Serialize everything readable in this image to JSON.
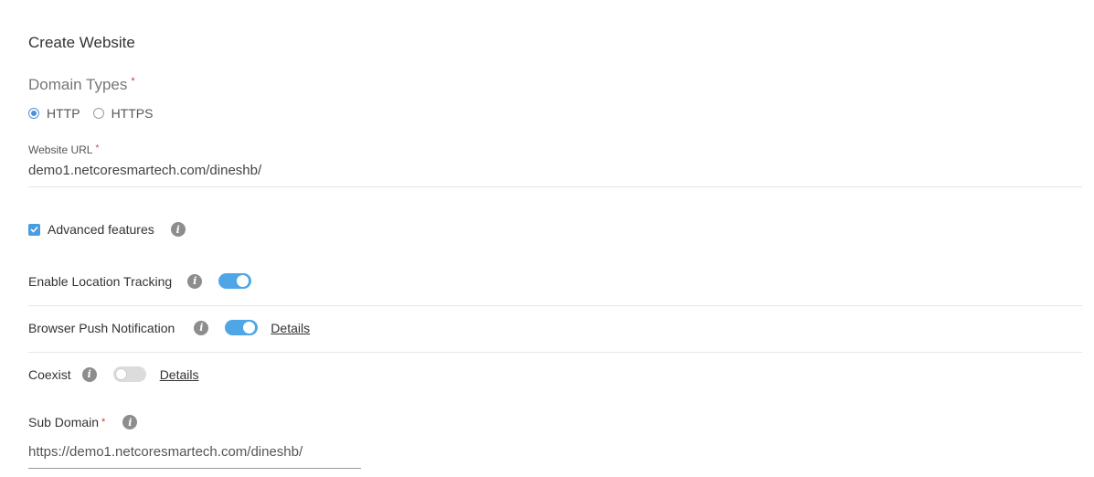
{
  "page": {
    "title": "Create Website"
  },
  "domain_types": {
    "label": "Domain Types",
    "required_mark": "*",
    "options": [
      {
        "label": "HTTP",
        "checked": true
      },
      {
        "label": "HTTPS",
        "checked": false
      }
    ]
  },
  "website_url": {
    "label": "Website URL",
    "required_mark": "*",
    "value": "demo1.netcoresmartech.com/dineshb/"
  },
  "advanced": {
    "label": "Advanced features",
    "checked": true,
    "info_icon": "info-icon"
  },
  "location_tracking": {
    "label": "Enable Location Tracking",
    "enabled": true
  },
  "browser_push": {
    "label": "Browser Push Notification",
    "enabled": true,
    "details_link": "Details"
  },
  "coexist": {
    "label": "Coexist",
    "enabled": false,
    "details_link": "Details"
  },
  "sub_domain": {
    "label": "Sub Domain",
    "required_mark": "*",
    "value": "https://demo1.netcoresmartech.com/dineshb/"
  },
  "colors": {
    "accent": "#4ea6e6",
    "required": "#e0322f",
    "info_icon": "#8d8d8d"
  }
}
